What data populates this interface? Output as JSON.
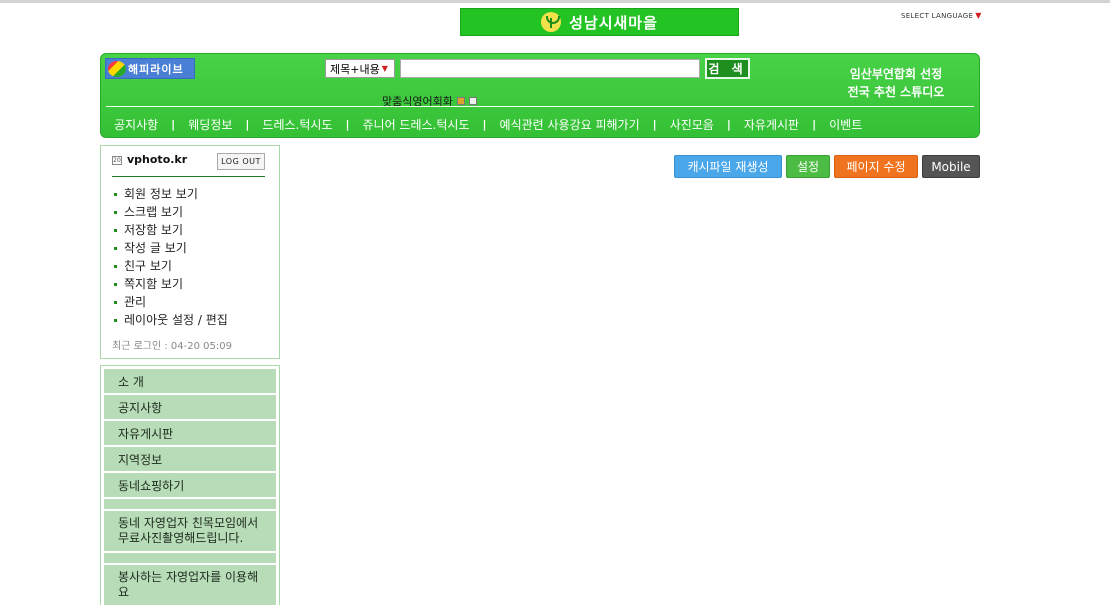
{
  "banner": {
    "title": "성남시새마을"
  },
  "language": {
    "label": "SELECT LANGUAGE"
  },
  "header": {
    "logo_text": "해피라이브",
    "search_scope": "제목+내용",
    "search_value": "",
    "search_button": "검 색",
    "keyword": "맞춤식영어회화",
    "promo_line1": "임산부연합회 선정",
    "promo_line2": "전국 추천 스튜디오"
  },
  "nav": {
    "items": [
      {
        "label": "공지사항"
      },
      {
        "label": "웨딩정보"
      },
      {
        "label": "드레스.턱시도"
      },
      {
        "label": "쥬니어 드레스.턱시도"
      },
      {
        "label": "예식관련 사용강요 피해가기"
      },
      {
        "label": "사진모음"
      },
      {
        "label": "자유게시판"
      },
      {
        "label": "이벤트"
      }
    ],
    "separator": "|"
  },
  "user": {
    "badge": "20",
    "name": "vphoto.kr",
    "logout_label": "LOG OUT",
    "links": [
      {
        "label": "회원 정보 보기"
      },
      {
        "label": "스크랩 보기"
      },
      {
        "label": "저장함 보기"
      },
      {
        "label": "작성 글 보기"
      },
      {
        "label": "친구 보기"
      },
      {
        "label": "쪽지함 보기"
      },
      {
        "label": "관리"
      },
      {
        "label": "레이아웃 설정 / 편집"
      }
    ],
    "last_login": "최근 로그인 : 04-20 05:09"
  },
  "menu": {
    "items": [
      {
        "label": "소 개"
      },
      {
        "label": "공지사항"
      },
      {
        "label": "자유게시판"
      },
      {
        "label": "지역정보"
      },
      {
        "label": "동네쇼핑하기"
      },
      {
        "label": ""
      },
      {
        "label": "동네 자영업자 친목모임에서 무료사진촬영해드립니다."
      },
      {
        "label": ""
      },
      {
        "label": "봉사하는 자영업자를 이용해요"
      }
    ]
  },
  "actions": {
    "cache": "캐시파일 재생성",
    "settings": "설정",
    "edit": "페이지 수정",
    "mobile": "Mobile"
  },
  "colors": {
    "header_green": "#3cc63c",
    "menu_item_bg": "#b7dcb7",
    "cache_btn": "#4aa7ea",
    "settings_btn": "#4cbc44",
    "edit_btn": "#f07420",
    "mobile_btn": "#555555"
  }
}
